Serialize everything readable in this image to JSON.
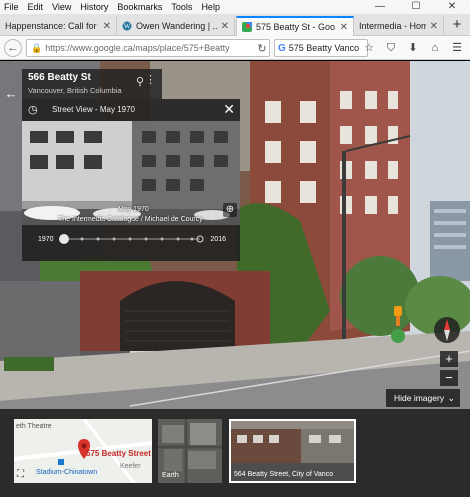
{
  "menubar": {
    "items": [
      "File",
      "Edit",
      "View",
      "History",
      "Bookmarks",
      "Tools",
      "Help"
    ]
  },
  "tabs": [
    {
      "title": "Happenstance: Call for ..."
    },
    {
      "title": "Owen Wandering | ..."
    },
    {
      "title": "575 Beatty St - Goo..."
    },
    {
      "title": "Intermedia - Home"
    }
  ],
  "navbar": {
    "url": "https://www.google.ca/maps/place/575+Beatty",
    "search_text": "575 Beatty Vanco"
  },
  "place": {
    "title": "566 Beatty St",
    "subtitle": "Vancouver, British Columbia"
  },
  "timemachine": {
    "label": "Street View - May 1970",
    "photo_date": "May 1970",
    "credit": "The Intermedia Catalogue / Michael de Courcy",
    "start_year": "1970",
    "end_year": "2016",
    "selected_fraction": 0.0
  },
  "controls": {
    "hide_imagery": "Hide imagery",
    "zoom_in": "+",
    "zoom_out": "−"
  },
  "carousel": {
    "map_card": {
      "label": "575 Beatty Street",
      "theatre": "eth Theatre",
      "station": "Stadium-Chinatown",
      "street": "Keefer"
    },
    "earth_card": {
      "label": "Earth"
    },
    "sv_card": {
      "label": "564 Beatty Street, City of Vanco"
    }
  },
  "colors": {
    "accent": "#0a84ff",
    "pin_red": "#d9342b",
    "pegman_orange": "#f39c12"
  }
}
